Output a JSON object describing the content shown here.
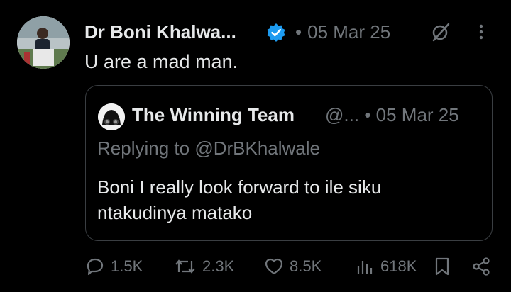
{
  "tweet": {
    "author_name": "Dr Boni Khalwa...",
    "date": "05 Mar 25",
    "separator": "•",
    "text": "U are a mad man."
  },
  "quoted": {
    "author_name": "The Winning Team",
    "handle": "@...",
    "separator": "•",
    "date": "05 Mar 25",
    "replying_prefix": "Replying to",
    "replying_mention": "@DrBKhalwale",
    "text_line1": "Boni I really look forward to ile siku",
    "text_line2": "ntakudinya matako"
  },
  "actions": {
    "replies": "1.5K",
    "reposts": "2.3K",
    "likes": "8.5K",
    "views": "618K"
  },
  "colors": {
    "background": "#000000",
    "text": "#e7e9ea",
    "muted": "#71767b",
    "verified": "#1d9bf0",
    "border": "#3a3e42"
  },
  "icons": [
    "verified-badge-icon",
    "grok-icon",
    "more-icon",
    "reply-icon",
    "repost-icon",
    "like-icon",
    "views-icon",
    "bookmark-icon",
    "share-icon"
  ]
}
